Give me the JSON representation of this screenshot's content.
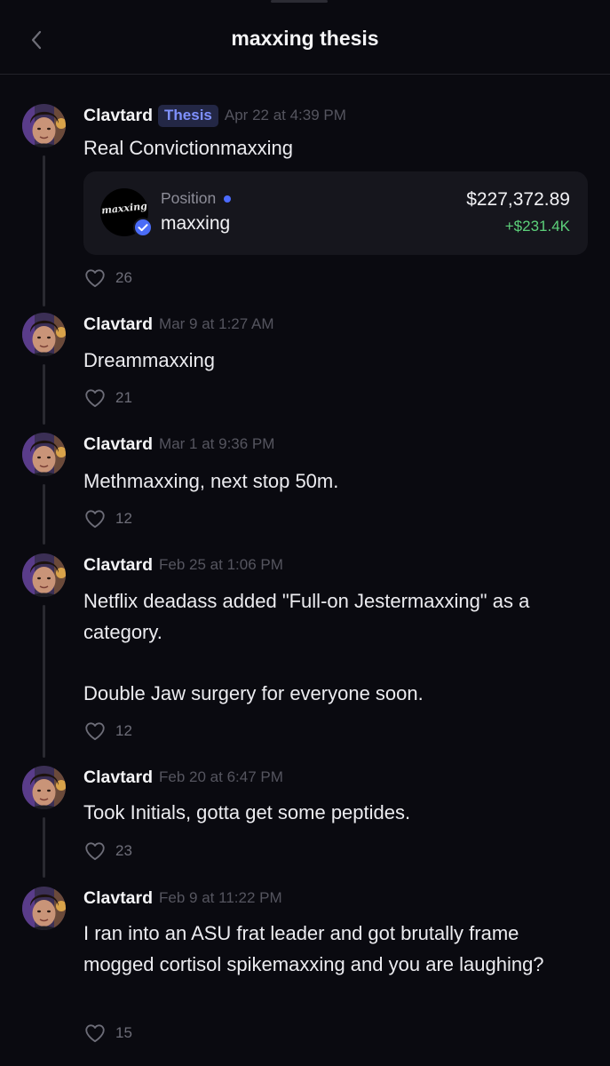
{
  "header": {
    "title": "maxxing thesis",
    "back_icon": "chevron-left-icon"
  },
  "colors": {
    "background": "#0a0a10",
    "badge_text": "#7f91ff",
    "badge_bg": "#232745",
    "gain": "#5cd07a",
    "live_dot": "#4c6bff"
  },
  "posts": [
    {
      "author": "Clavtard",
      "badge": "Thesis",
      "timestamp": "Apr 22 at 4:39 PM",
      "text": "Real Convictionmaxxing",
      "likes": "26",
      "position": {
        "label": "Position",
        "token_name": "maxxing",
        "token_logo_text": "maxxing",
        "value": "$227,372.89",
        "change": "+$231.4K"
      }
    },
    {
      "author": "Clavtard",
      "timestamp": "Mar 9 at 1:27 AM",
      "text": "Dreammaxxing",
      "likes": "21"
    },
    {
      "author": "Clavtard",
      "timestamp": "Mar 1 at 9:36 PM",
      "text": "Methmaxxing, next stop 50m.",
      "likes": "12"
    },
    {
      "author": "Clavtard",
      "timestamp": "Feb 25 at 1:06 PM",
      "text": "Netflix deadass added \"Full-on Jestermaxxing\" as a category.\n\nDouble Jaw surgery for everyone soon.",
      "likes": "12"
    },
    {
      "author": "Clavtard",
      "timestamp": "Feb 20 at 6:47 PM",
      "text": "Took Initials, gotta get some peptides.",
      "likes": "23"
    },
    {
      "author": "Clavtard",
      "timestamp": "Feb 9 at 11:22 PM",
      "text": "I ran into an ASU frat leader and got brutally frame mogged cortisol spikemaxxing and you are laughing?",
      "likes": "15"
    }
  ]
}
